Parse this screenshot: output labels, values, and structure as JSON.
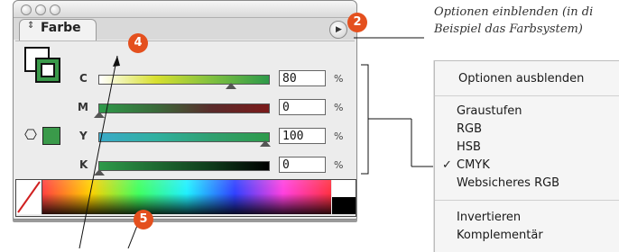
{
  "window": {
    "tab_label": "Farbe",
    "tab_arrows": "⇕",
    "menu_button_glyph": "▶"
  },
  "channels": [
    {
      "label": "C",
      "value": "80",
      "unit": "%",
      "slider_level": 0.8
    },
    {
      "label": "M",
      "value": "0",
      "unit": "%",
      "slider_level": 0.0
    },
    {
      "label": "Y",
      "value": "100",
      "unit": "%",
      "slider_level": 1.0
    },
    {
      "label": "K",
      "value": "0",
      "unit": "%",
      "slider_level": 0.0
    }
  ],
  "colors": {
    "panel_bg": "#ececec",
    "fill_color": "#3a9a4a",
    "callout": "#e4501e"
  },
  "callouts": [
    {
      "number": "2"
    },
    {
      "number": "4"
    },
    {
      "number": "5"
    }
  ],
  "caption": {
    "line1": "Optionen einblenden (in di",
    "line2": "Beispiel das Farbsystem)"
  },
  "menu": {
    "items": [
      {
        "label": "Optionen ausblenden"
      },
      {
        "label": "Graustufen"
      },
      {
        "label": "RGB"
      },
      {
        "label": "HSB"
      },
      {
        "label": "CMYK",
        "checked": true
      },
      {
        "label": "Websicheres RGB"
      },
      {
        "label": "Invertieren"
      },
      {
        "label": "Komplementär"
      }
    ],
    "check_glyph": "✓"
  },
  "icons": {
    "cube": "⎔"
  }
}
